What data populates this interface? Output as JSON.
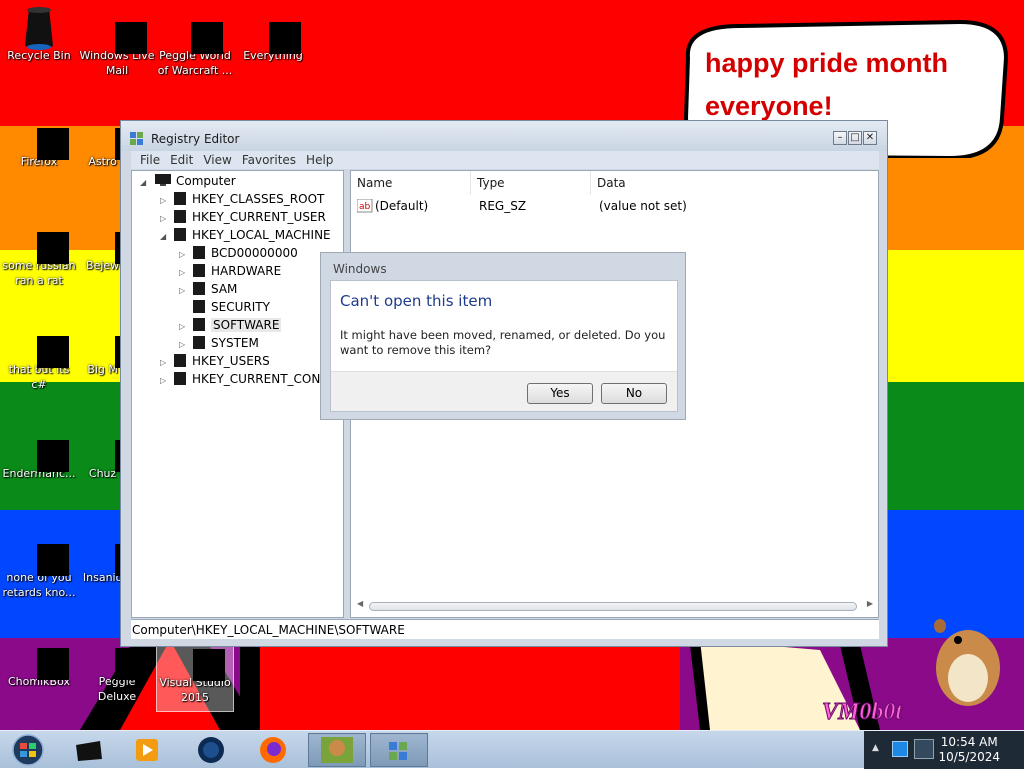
{
  "desktop": {
    "colors": {
      "red": "#ff0000",
      "orange": "#ff8000",
      "yellow": "#ffff00",
      "green": "#008000",
      "blue": "#0040ff",
      "purple": "#800080"
    },
    "icons": [
      {
        "label": "Recycle Bin",
        "icon": "recycle-bin-icon"
      },
      {
        "label": "Windows Live Mail",
        "icon": "mail-icon"
      },
      {
        "label": "Peggle World of Warcraft ...",
        "icon": "peggle-icon"
      },
      {
        "label": "Everything",
        "icon": "search-icon"
      },
      {
        "label": "Firefox",
        "icon": "firefox-icon"
      },
      {
        "label": "Astro Delu",
        "icon": "game-icon"
      },
      {
        "label": "some russian ran a rat",
        "icon": "document-icon"
      },
      {
        "label": "Bejew Delu",
        "icon": "game-icon"
      },
      {
        "label": "that but its c#",
        "icon": "folder-icon"
      },
      {
        "label": "Big M Delu",
        "icon": "game-icon"
      },
      {
        "label": "Endermanc...",
        "icon": "app-icon"
      },
      {
        "label": "Chuz Delu",
        "icon": "game-icon"
      },
      {
        "label": "none of you retards kno...",
        "icon": "app-icon"
      },
      {
        "label": "Insanio Delu",
        "icon": "game-icon"
      },
      {
        "label": "ChomikBox",
        "icon": "hamster-icon"
      },
      {
        "label": "Peggle Deluxe",
        "icon": "peggle-icon"
      },
      {
        "label": "Visual Studio 2015",
        "icon": "visual-studio-icon"
      }
    ],
    "bubble_text": "happy pride month everyone!",
    "watermark": "VM0b0t"
  },
  "window": {
    "title": "Registry Editor",
    "menu": [
      "File",
      "Edit",
      "View",
      "Favorites",
      "Help"
    ],
    "tree": {
      "root": "Computer",
      "items": [
        {
          "label": "HKEY_CLASSES_ROOT",
          "level": 1,
          "expander": "▷"
        },
        {
          "label": "HKEY_CURRENT_USER",
          "level": 1,
          "expander": "▷"
        },
        {
          "label": "HKEY_LOCAL_MACHINE",
          "level": 1,
          "expander": "◢"
        },
        {
          "label": "BCD00000000",
          "level": 2,
          "expander": "▷"
        },
        {
          "label": "HARDWARE",
          "level": 2,
          "expander": "▷"
        },
        {
          "label": "SAM",
          "level": 2,
          "expander": "▷"
        },
        {
          "label": "SECURITY",
          "level": 2,
          "expander": ""
        },
        {
          "label": "SOFTWARE",
          "level": 2,
          "expander": "▷",
          "selected": true
        },
        {
          "label": "SYSTEM",
          "level": 2,
          "expander": "▷"
        },
        {
          "label": "HKEY_USERS",
          "level": 1,
          "expander": "▷"
        },
        {
          "label": "HKEY_CURRENT_CONFI",
          "level": 1,
          "expander": "▷"
        }
      ]
    },
    "list": {
      "columns": [
        "Name",
        "Type",
        "Data"
      ],
      "rows": [
        {
          "name": "(Default)",
          "type": "REG_SZ",
          "data": "(value not set)"
        }
      ]
    },
    "status": "Computer\\HKEY_LOCAL_MACHINE\\SOFTWARE"
  },
  "dialog": {
    "title": "Windows",
    "headline": "Can't open this item",
    "message": "It might have been moved, renamed, or deleted. Do you want to remove this item?",
    "yes_label": "Yes",
    "no_label": "No"
  },
  "taskbar": {
    "items": [
      "start-orb-icon",
      "desktop-icon",
      "media-player-icon",
      "globe-icon",
      "firefox-icon",
      "chomikbox-icon",
      "registry-editor-icon"
    ],
    "time": "10:54 AM",
    "date": "10/5/2024"
  }
}
